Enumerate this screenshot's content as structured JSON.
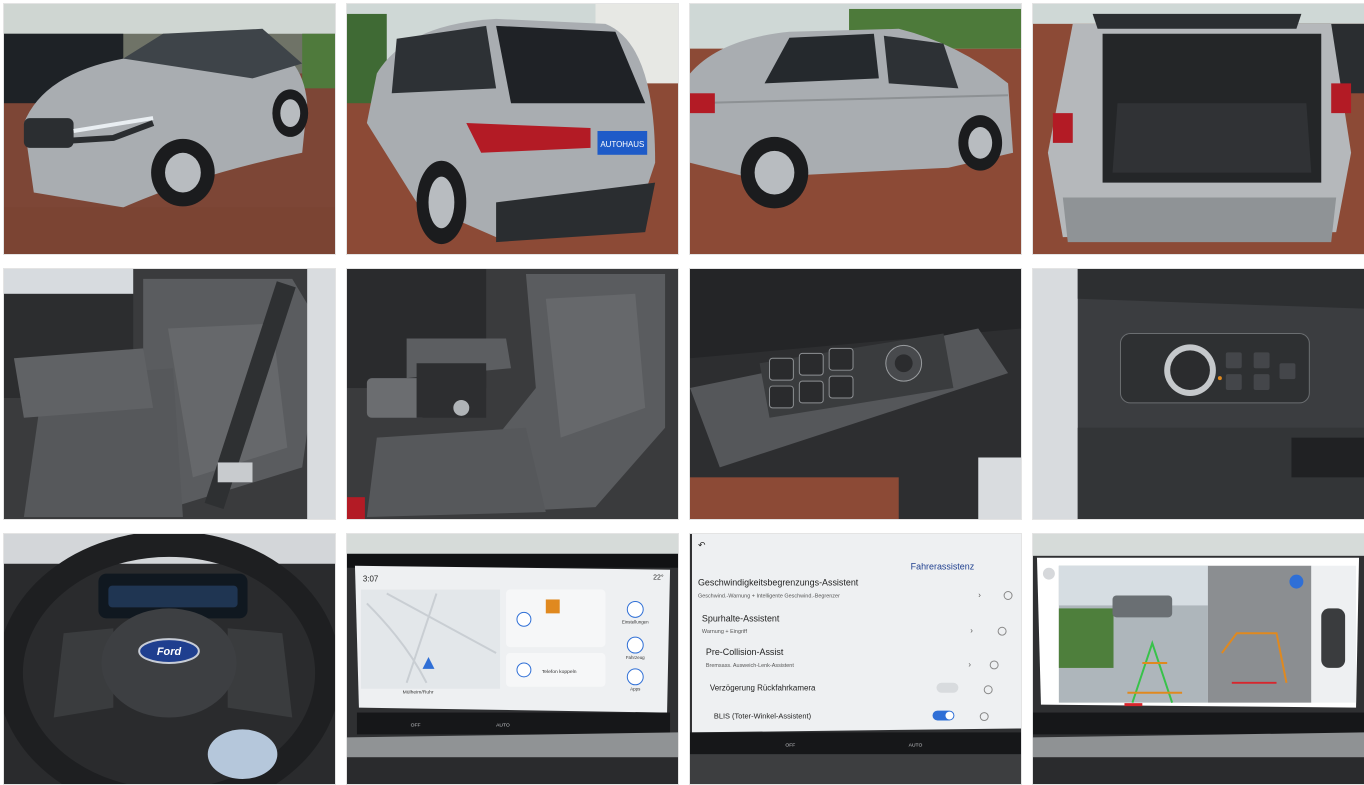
{
  "gallery": {
    "photos": [
      {
        "subject": "exterior-front-three-quarter"
      },
      {
        "subject": "exterior-rear-three-quarter"
      },
      {
        "subject": "exterior-side"
      },
      {
        "subject": "trunk-open"
      },
      {
        "subject": "rear-seats"
      },
      {
        "subject": "front-seats"
      },
      {
        "subject": "door-window-switches"
      },
      {
        "subject": "light-switch-panel"
      },
      {
        "subject": "steering-wheel"
      },
      {
        "subject": "infotainment-map"
      },
      {
        "subject": "infotainment-driver-assist"
      },
      {
        "subject": "rear-camera-display"
      }
    ]
  },
  "badges": {
    "steering_logo": "Ford",
    "plate_text": "AUTOHAUS"
  },
  "screen_map": {
    "time": "3:07",
    "temp": "22°",
    "address": "Mülheim/Ruhr",
    "side_a": "Einstellungen",
    "side_b": "Fahrzeug",
    "side_c": "Apps",
    "phone": "Telefon koppeln",
    "bar_off": "OFF",
    "bar_auto": "AUTO"
  },
  "screen_assist": {
    "title": "Fahrerassistenz",
    "items": [
      {
        "label": "Geschwindigkeitsbegrenzungs-Assistent",
        "sub": "Geschwind.-Warnung + Intelligente Geschwind.-Begrenzer"
      },
      {
        "label": "Spurhalte-Assistent",
        "sub": "Warnung + Eingriff"
      },
      {
        "label": "Pre-Collision-Assist",
        "sub": "Bremsass. Ausweich-Lenk-Assistent"
      },
      {
        "label": "Verzögerung Rückfahrkamera",
        "sub": ""
      },
      {
        "label": "BLIS (Toter-Winkel-Assistent)",
        "sub": ""
      }
    ],
    "bar_off": "OFF",
    "bar_auto": "AUTO"
  },
  "colors": {
    "car_silver": "#a9adb1",
    "brick": "#8c4a36",
    "interior_dark": "#3a3b3d",
    "seat_grey": "#5a5c5f",
    "screen_bg": "#eef0f2",
    "ford_blue": "#1f3f8f",
    "accent_blue": "#2f6fd6",
    "taillight_red": "#b31b25"
  }
}
